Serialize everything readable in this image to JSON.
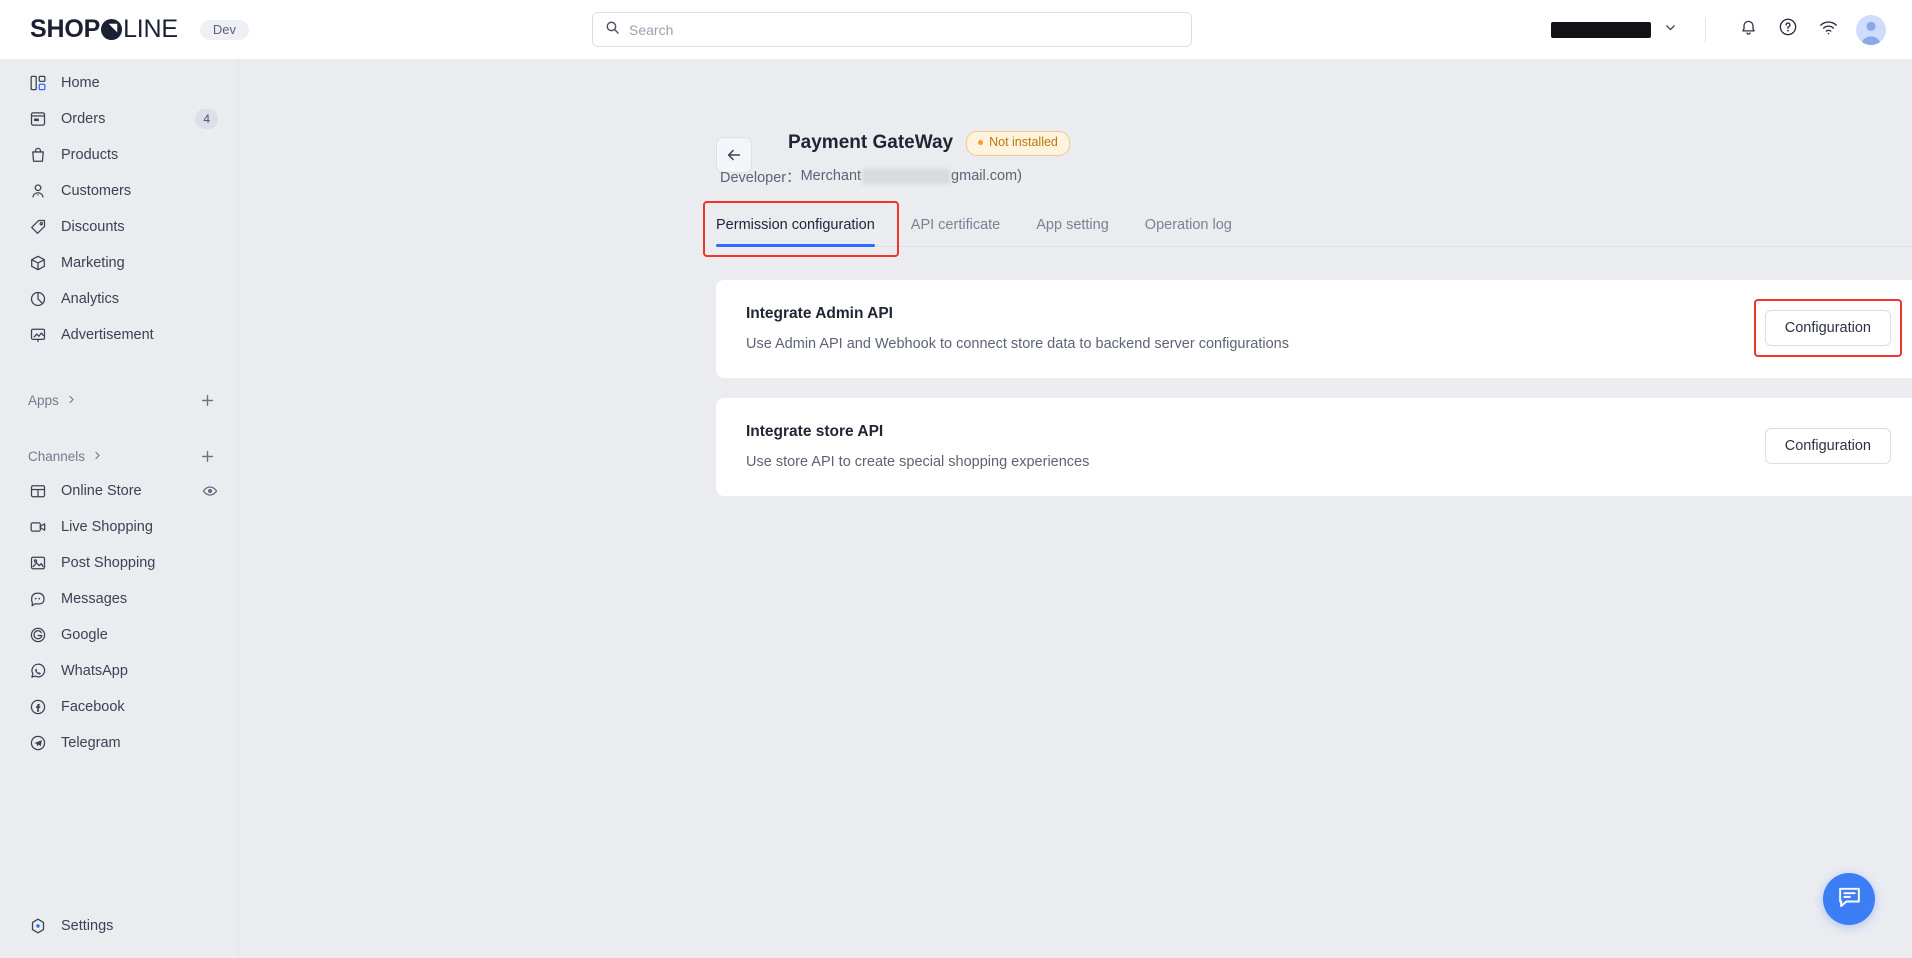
{
  "brand": {
    "logo_bold": "SHOP",
    "logo_light": "LINE",
    "dev_pill": "Dev",
    "accent_blue": "#2f6bff",
    "background": "#eaecf0",
    "panel": "#ffffff",
    "warning": "#c2750a",
    "annotation_red": "#f0352b"
  },
  "search": {
    "placeholder": "Search",
    "value": ""
  },
  "topbar": {
    "store_name": "",
    "icons": [
      "bell-icon",
      "help-icon",
      "wifi-icon",
      "avatar"
    ]
  },
  "sidebar": {
    "items": [
      {
        "label": "Home",
        "icon": "home-icon",
        "badge": ""
      },
      {
        "label": "Orders",
        "icon": "orders-icon",
        "badge": "4"
      },
      {
        "label": "Products",
        "icon": "products-icon",
        "badge": ""
      },
      {
        "label": "Customers",
        "icon": "customers-icon",
        "badge": ""
      },
      {
        "label": "Discounts",
        "icon": "discounts-icon",
        "badge": ""
      },
      {
        "label": "Marketing",
        "icon": "marketing-icon",
        "badge": ""
      },
      {
        "label": "Analytics",
        "icon": "analytics-icon",
        "badge": ""
      },
      {
        "label": "Advertisement",
        "icon": "advertisement-icon",
        "badge": ""
      }
    ],
    "apps_section": {
      "label": "Apps",
      "add_label": "+"
    },
    "channels_section": {
      "label": "Channels",
      "add_label": "+"
    },
    "channels": [
      {
        "label": "Online Store",
        "icon": "store-icon",
        "trailing": "eye-icon"
      },
      {
        "label": "Live Shopping",
        "icon": "video-icon",
        "trailing": ""
      },
      {
        "label": "Post Shopping",
        "icon": "image-icon",
        "trailing": ""
      },
      {
        "label": "Messages",
        "icon": "message-icon",
        "trailing": ""
      },
      {
        "label": "Google",
        "icon": "google-icon",
        "trailing": ""
      },
      {
        "label": "WhatsApp",
        "icon": "whatsapp-icon",
        "trailing": ""
      },
      {
        "label": "Facebook",
        "icon": "facebook-icon",
        "trailing": ""
      },
      {
        "label": "Telegram",
        "icon": "telegram-icon",
        "trailing": ""
      }
    ],
    "settings": {
      "label": "Settings",
      "icon": "settings-icon"
    }
  },
  "page": {
    "title": "Payment GateWay",
    "status": "Not installed",
    "developer_prefix": "Developer：",
    "developer_name": "Merchant",
    "developer_suffix": "gmail.com)"
  },
  "tabs": [
    {
      "label": "Permission configuration",
      "active": true
    },
    {
      "label": "API certificate",
      "active": false
    },
    {
      "label": "App setting",
      "active": false
    },
    {
      "label": "Operation log",
      "active": false
    }
  ],
  "cards": [
    {
      "title": "Integrate Admin API",
      "desc": "Use Admin API and Webhook to connect store data to backend server configurations",
      "button": "Configuration",
      "highlighted": true
    },
    {
      "title": "Integrate store API",
      "desc": "Use store API to create special shopping experiences",
      "button": "Configuration",
      "highlighted": false
    }
  ],
  "chat": {
    "icon": "chat-icon"
  }
}
